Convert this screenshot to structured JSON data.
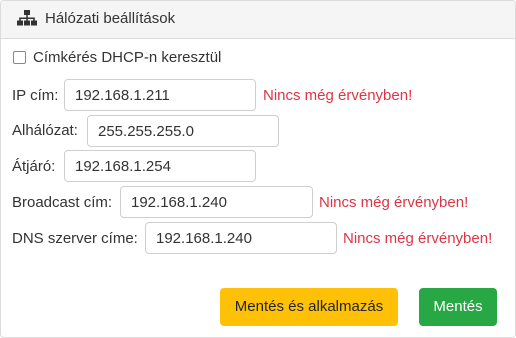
{
  "header": {
    "title": "Hálózati beállítások",
    "icon": "network-icon"
  },
  "dhcp": {
    "label": "Címkérés DHCP-n keresztül",
    "checked": false
  },
  "fields": [
    {
      "label": "IP cím:",
      "value": "192.168.1.211",
      "warning": "Nincs még érvényben!"
    },
    {
      "label": "Alhálózat:",
      "value": "255.255.255.0",
      "warning": ""
    },
    {
      "label": "Átjáró:",
      "value": "192.168.1.254",
      "warning": ""
    },
    {
      "label": "Broadcast cím:",
      "value": "192.168.1.240",
      "warning": "Nincs még érvényben!"
    },
    {
      "label": "DNS szerver címe:",
      "value": "192.168.1.240",
      "warning": "Nincs még érvényben!"
    }
  ],
  "buttons": {
    "apply": "Mentés és alkalmazás",
    "save": "Mentés"
  },
  "colors": {
    "warning": "#dc3545",
    "apply": "#ffc107",
    "save": "#28a745"
  }
}
